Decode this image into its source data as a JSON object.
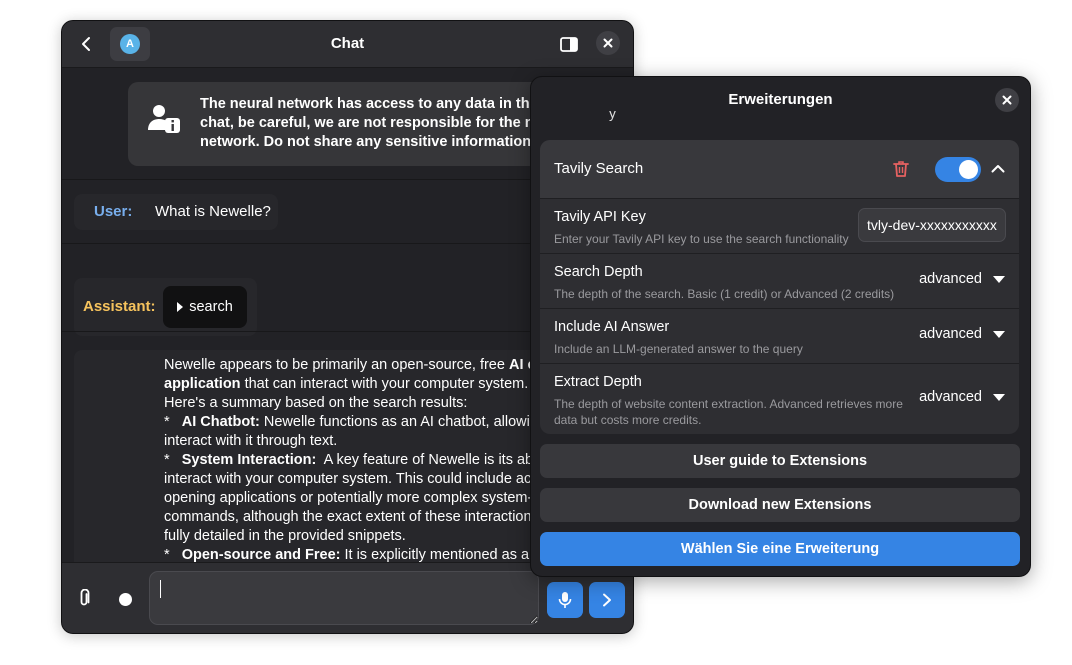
{
  "chat": {
    "title": "Chat",
    "avatar_letter": "A",
    "warning": "The neural network has access to any data in this\nchat, be careful, we are not responsible for the neural\nnetwork. Do not share any sensitive information.",
    "user_label": "User:",
    "user_message": "What is Newelle?",
    "assistant_label": "Assistant:",
    "tool_chip_label": "search",
    "answer_lines": [
      {
        "prefix": "",
        "bold": "",
        "text": "Newelle appears to be primarily an open-source, free ",
        "tail_bold": "AI chatbot"
      },
      {
        "prefix": "",
        "bold": "application",
        "text": " that can interact with your computer system.",
        "tail_bold": ""
      },
      {
        "prefix": "",
        "bold": "",
        "text": "Here's a summary based on the search results:",
        "tail_bold": ""
      },
      {
        "prefix": "*   ",
        "bold": "AI Chatbot:",
        "text": " Newelle functions as an AI chatbot, allowing users to",
        "tail_bold": ""
      },
      {
        "prefix": "",
        "bold": "",
        "text": "interact with it through text.",
        "tail_bold": ""
      },
      {
        "prefix": "*   ",
        "bold": "System Interaction:",
        "text": "  A key feature of Newelle is its ability to",
        "tail_bold": ""
      },
      {
        "prefix": "",
        "bold": "",
        "text": "interact with your computer system. This could include actions like",
        "tail_bold": ""
      },
      {
        "prefix": "",
        "bold": "",
        "text": "opening applications or potentially more complex system-level",
        "tail_bold": ""
      },
      {
        "prefix": "",
        "bold": "",
        "text": "commands, although the exact extent of these interactions isn't",
        "tail_bold": ""
      },
      {
        "prefix": "",
        "bold": "",
        "text": "fully detailed in the provided snippets.",
        "tail_bold": ""
      },
      {
        "prefix": "*   ",
        "bold": "Open-source and Free:",
        "text": " It is explicitly mentioned as a free and",
        "tail_bold": ""
      }
    ],
    "input_value": ""
  },
  "extensions": {
    "title": "Erweiterungen",
    "extension_name": "Tavily Search",
    "enabled": true,
    "rows": [
      {
        "title": "Tavily API Key",
        "subtitle": "Enter your Tavily API key to use the search functionality",
        "value": "tvly-dev-xxxxxxxxxxxxxxxx"
      },
      {
        "title": "Search Depth",
        "subtitle": "The depth of the search. Basic (1 credit) or Advanced (2 credits)",
        "value": "advanced"
      },
      {
        "title": "Include AI Answer",
        "subtitle": "Include an LLM-generated answer to the query",
        "value": "advanced"
      },
      {
        "title": "Extract Depth",
        "subtitle": "The depth of website content extraction. Advanced retrieves more data but costs more credits.",
        "value": "advanced"
      }
    ],
    "buttons": {
      "guide": "User guide to Extensions",
      "download": "Download new Extensions",
      "choose": "Wählen Sie eine Erweiterung"
    }
  },
  "colors": {
    "accent": "#3584e4",
    "user_label": "#78aeed",
    "assistant_label": "#f6c35d",
    "destructive": "#e66161"
  }
}
